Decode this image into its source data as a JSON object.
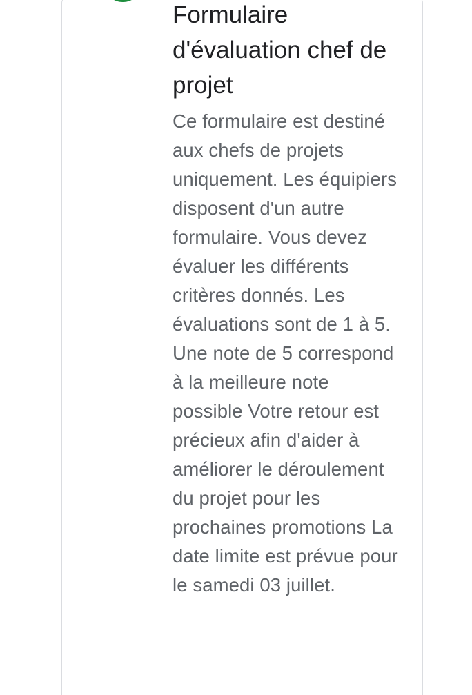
{
  "form": {
    "title": "Formulaire d'évaluation chef de projet",
    "description": "Ce formulaire est destiné aux chefs de projets uniquement. Les équipiers disposent d'un autre formulaire. Vous devez évaluer les différents critères donnés. Les évaluations sont de 1 à 5. Une note de 5 correspond à la meilleure note possible Votre retour est précieux afin d'aider à améliorer le déroulement du projet pour les prochaines promotions La date limite est prévue pour le samedi 03 juillet.",
    "icon": "form-icon",
    "accent_color": "#1e8e3e"
  }
}
